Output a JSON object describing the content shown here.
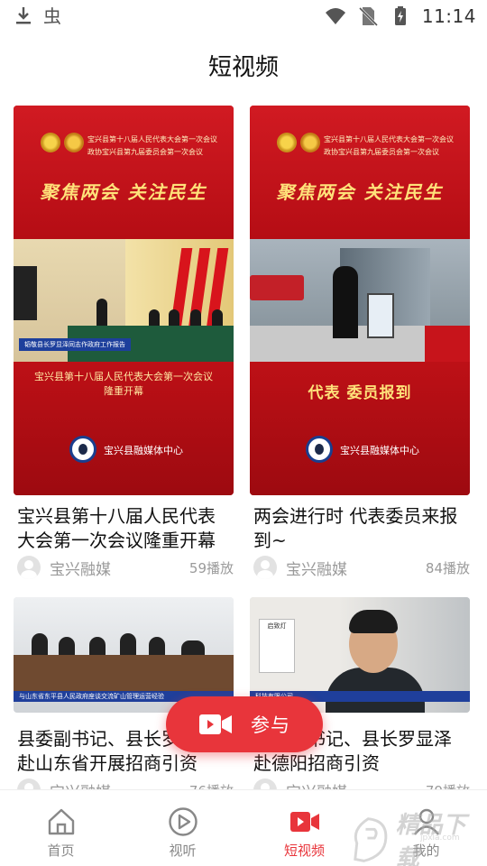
{
  "status_bar": {
    "time": "11:14",
    "left_icons": [
      "download-icon",
      "bug-icon"
    ],
    "right_icons": [
      "wifi-icon",
      "no-sim-icon",
      "battery-charging-icon"
    ]
  },
  "header": {
    "title": "短视频"
  },
  "videos": [
    {
      "title": "宝兴县第十八届人民代表大会第一次会议隆重开幕",
      "author": "宝兴融媒",
      "plays": "59播放",
      "thumb": {
        "header1": "宝兴县第十八届人民代表大会第一次会议",
        "header2": "政协宝兴县第九届委员会第一次会议",
        "slogan": "聚焦两会 关注民生",
        "caption": "韬敬县长罗显泽同志作政府工作报告",
        "sub1": "宝兴县第十八届人民代表大会第一次会议",
        "sub2": "隆重开幕",
        "center": "宝兴县融媒体中心"
      }
    },
    {
      "title": "两会进行时 代表委员来报到~",
      "author": "宝兴融媒",
      "plays": "84播放",
      "thumb": {
        "header1": "宝兴县第十八届人民代表大会第一次会议",
        "header2": "政协宝兴县第九届委员会第一次会议",
        "slogan": "聚焦两会 关注民生",
        "big": "代表 委员报到",
        "center": "宝兴县融媒体中心"
      }
    },
    {
      "title": "县委副书记、县长罗显泽赴山东省开展招商引资",
      "author": "宝兴融媒",
      "plays": "76播放",
      "thumb": {
        "ticker": "与山东省东平县人民政府座谈交流矿山管理运营经验"
      }
    },
    {
      "title": "县委副书记、县长罗显泽赴德阳招商引资",
      "author": "宝兴融媒",
      "plays": "79播放",
      "thumb": {
        "ticker": "科技有限公司",
        "sign": "启致灯"
      }
    }
  ],
  "fab": {
    "label": "参与",
    "icon": "video-camera-icon"
  },
  "bottom_nav": [
    {
      "label": "首页",
      "icon": "home-icon",
      "active": false
    },
    {
      "label": "视听",
      "icon": "play-circle-icon",
      "active": false
    },
    {
      "label": "短视频",
      "icon": "video-camera-icon",
      "active": true
    },
    {
      "label": "我的",
      "icon": "user-icon",
      "active": false
    }
  ],
  "watermark": {
    "text": "精品下载",
    "sub": "jpxia.com"
  },
  "colors": {
    "accent": "#e8353b",
    "text_gray": "#9a9a9a"
  }
}
